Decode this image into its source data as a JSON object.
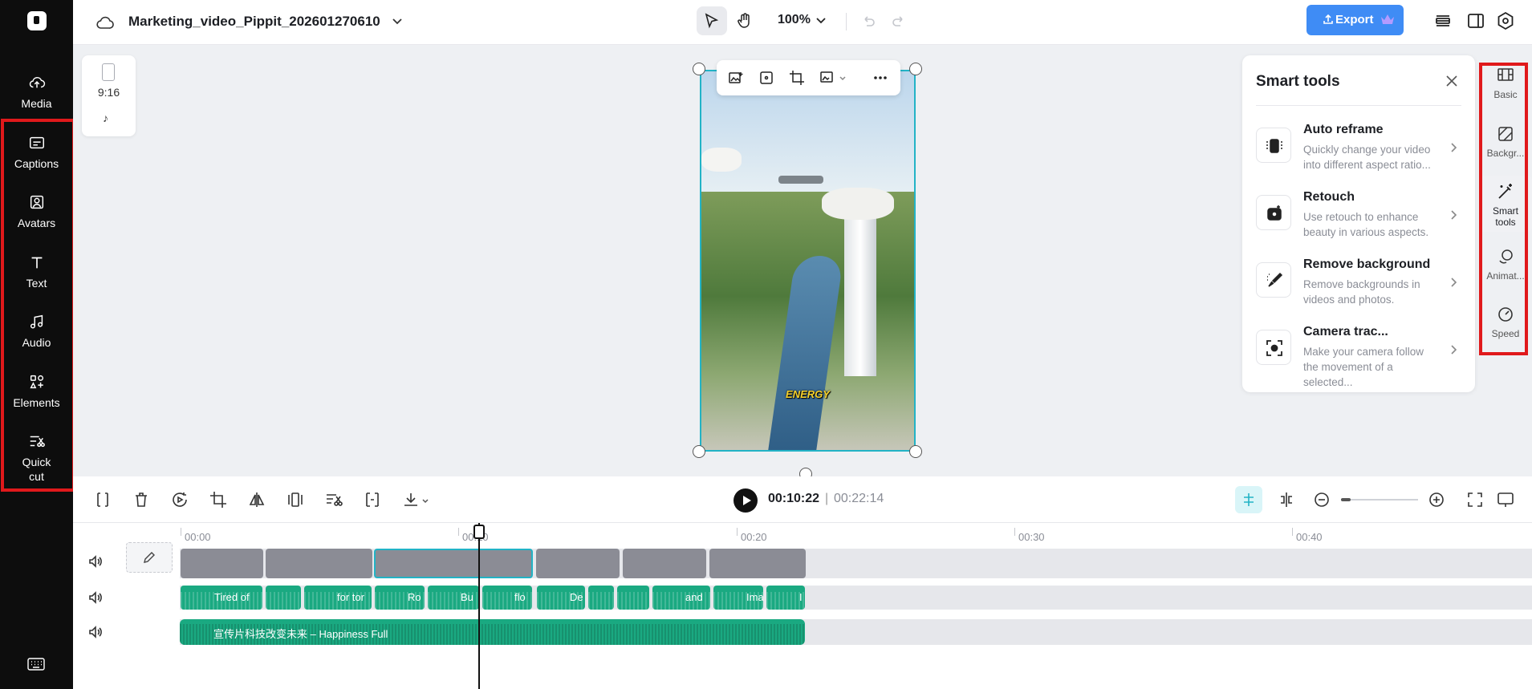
{
  "left_nav": {
    "items": [
      {
        "label": "Media",
        "icon": "cloud-upload-icon"
      },
      {
        "label": "Captions",
        "icon": "captions-icon"
      },
      {
        "label": "Avatars",
        "icon": "avatar-icon"
      },
      {
        "label": "Text",
        "icon": "text-icon"
      },
      {
        "label": "Audio",
        "icon": "music-note-icon"
      },
      {
        "label": "Elements",
        "icon": "elements-icon"
      },
      {
        "label": "Quick\ncut",
        "icon": "quick-cut-icon"
      }
    ]
  },
  "header": {
    "project_title": "Marketing_video_Pippit_202601270610",
    "zoom": "100%",
    "export_label": "Export"
  },
  "canvas": {
    "aspect_ratio": "9:16",
    "caption_word": "ENERGY"
  },
  "smart_tools": {
    "title": "Smart tools",
    "tools": [
      {
        "name": "Auto reframe",
        "description": "Quickly change your video into different aspect ratio..."
      },
      {
        "name": "Retouch",
        "description": "Use retouch to enhance beauty in various aspects."
      },
      {
        "name": "Remove background",
        "description": "Remove backgrounds in videos and photos."
      },
      {
        "name": "Camera trac...",
        "description": "Make your camera follow the movement of a selected..."
      }
    ]
  },
  "property_bar": {
    "items": [
      {
        "label": "Basic",
        "icon": "basic-icon"
      },
      {
        "label": "Backgr...",
        "icon": "background-icon"
      },
      {
        "label": "Smart\ntools",
        "icon": "magic-wand-icon"
      },
      {
        "label": "Animat...",
        "icon": "animation-icon"
      },
      {
        "label": "Speed",
        "icon": "speed-icon"
      }
    ]
  },
  "playback": {
    "current_time": "00:10:22",
    "separator": "|",
    "total_time": "00:22:14"
  },
  "timeline": {
    "ruler": [
      "00:00",
      "00:10",
      "00:20",
      "00:30",
      "00:40"
    ],
    "caption_clips": [
      "Tired of",
      "for tor",
      "Ro",
      "Bu",
      "flo",
      "De",
      "and",
      "Ima",
      "I"
    ],
    "audio_clip_label": "宣传片科技改变未来 – Happiness Full"
  },
  "colors": {
    "accent": "#22b3c6",
    "export_button": "#3f8cf5",
    "caption_track": "#1aa981",
    "highlight_box": "#e0191b"
  }
}
